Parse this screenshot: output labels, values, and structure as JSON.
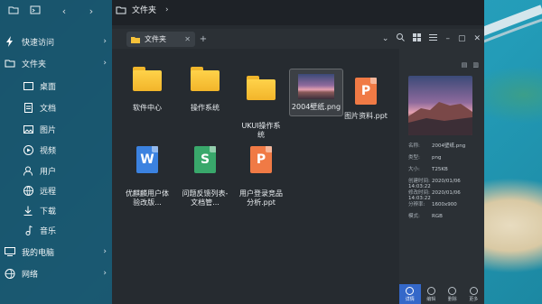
{
  "sidebar": {
    "top_buttons": [
      "folder-icon",
      "terminal-icon"
    ],
    "items": [
      {
        "label": "快速访问",
        "icon": "bolt-icon",
        "level": 1,
        "chevron": true
      },
      {
        "label": "文件夹",
        "icon": "folder-outline-icon",
        "level": 1,
        "chevron": true
      },
      {
        "label": "桌面",
        "icon": "desktop-icon",
        "level": 2
      },
      {
        "label": "文档",
        "icon": "document-icon",
        "level": 2
      },
      {
        "label": "图片",
        "icon": "image-icon",
        "level": 2
      },
      {
        "label": "视频",
        "icon": "video-icon",
        "level": 2
      },
      {
        "label": "用户",
        "icon": "user-icon",
        "level": 2
      },
      {
        "label": "远程",
        "icon": "remote-icon",
        "level": 2
      },
      {
        "label": "下载",
        "icon": "download-icon",
        "level": 2
      },
      {
        "label": "音乐",
        "icon": "music-icon",
        "level": 2
      },
      {
        "label": "我的电脑",
        "icon": "computer-icon",
        "level": 1,
        "chevron": true
      },
      {
        "label": "网络",
        "icon": "network-icon",
        "level": 1,
        "chevron": true
      }
    ]
  },
  "window": {
    "location": "文件夹",
    "tab_label": "文件夹",
    "tools": [
      "chevron-down-icon",
      "search-icon",
      "grid-view-icon",
      "list-view-icon",
      "minimize-icon",
      "maximize-icon",
      "close-icon"
    ]
  },
  "files": [
    {
      "name": "软件中心",
      "type": "folder"
    },
    {
      "name": "操作系统",
      "type": "folder"
    },
    {
      "name": "UKUI操作系\n统",
      "type": "folder"
    },
    {
      "name": "2004壁纸.png",
      "type": "image",
      "selected": true
    },
    {
      "name": "图片资料.ppt",
      "type": "ppt"
    },
    {
      "name": "优麒麟用户体\n验改版...",
      "type": "word"
    },
    {
      "name": "问题反馈列表-\n文档管...",
      "type": "excel"
    },
    {
      "name": "用户登录竞品\n分析.ppt",
      "type": "ppt"
    }
  ],
  "details": {
    "props": [
      {
        "k": "名称:",
        "v": "2004壁纸.png"
      },
      {
        "k": "类型:",
        "v": "png"
      },
      {
        "k": "大小:",
        "v": "T25KB"
      },
      {
        "k": "创建时间:",
        "v": "2020/01/06 14:03:22"
      },
      {
        "k": "修改时间:",
        "v": "2020/01/06 14:03:22"
      },
      {
        "k": "分辨率:",
        "v": "1600x900"
      },
      {
        "k": "模式:",
        "v": "RGB"
      }
    ],
    "actions": [
      {
        "label": "详情",
        "icon": "info-icon",
        "active": true
      },
      {
        "label": "编辑",
        "icon": "edit-icon"
      },
      {
        "label": "删除",
        "icon": "delete-icon"
      },
      {
        "label": "更多",
        "icon": "more-icon"
      }
    ]
  },
  "colors": {
    "sidebar_bg": "#184e66",
    "window_bg": "#262b30",
    "folder": "#f6c23a",
    "word": "#3b82e0",
    "excel": "#39a86b",
    "ppt": "#f07a45",
    "accent": "#3468c9"
  }
}
